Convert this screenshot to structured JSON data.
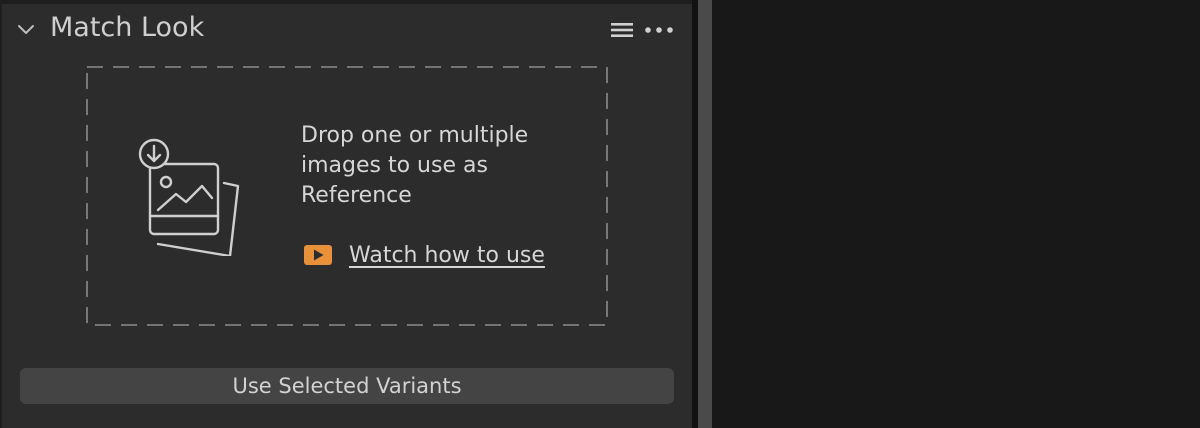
{
  "panel": {
    "title": "Match Look",
    "drop_zone": {
      "text": "Drop one or multiple images to use as Reference",
      "watch_link": "Watch how to use"
    },
    "button_label": "Use Selected Variants"
  },
  "icons": {
    "collapse": "chevron-down-icon",
    "menu": "hamburger-menu-icon",
    "more": "more-dots-icon",
    "drop": "image-drop-icon",
    "play": "play-video-icon"
  },
  "colors": {
    "panel_bg": "#2c2c2c",
    "viewer_bg": "#181818",
    "accent_play": "#e8913a",
    "text": "#d6d6d6",
    "button_bg": "#444444"
  }
}
